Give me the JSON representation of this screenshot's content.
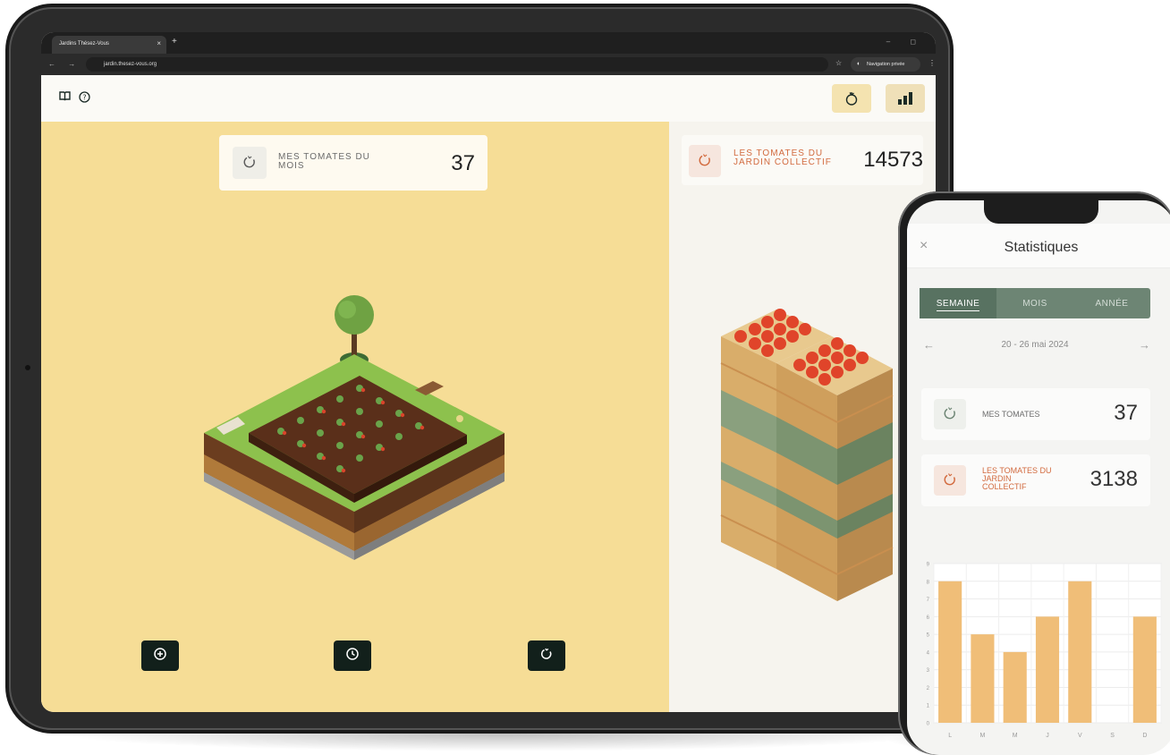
{
  "browser": {
    "tab_title": "Jardins Thésez-Vous",
    "tab_close": "×",
    "new_tab": "+",
    "window_controls": "–  ◻",
    "nav_buttons": "← → C",
    "url": "jardin.thesez-vous.org",
    "bookmark_icon": "star-icon",
    "private_label": "Navigation privée",
    "menu": "⋮"
  },
  "app_header": {
    "left_icons": [
      "book-icon",
      "help-icon"
    ],
    "right_buttons": [
      "tomato-icon",
      "stats-bars-icon"
    ]
  },
  "garden": {
    "card_label": "MES TOMATES DU MOIS",
    "card_value": "37",
    "actions": [
      "add-icon",
      "clock-icon",
      "tomato-icon"
    ]
  },
  "basket": {
    "card_label": "LES TOMATES DU JARDIN COLLECTIF",
    "card_value": "14573"
  },
  "phone": {
    "title": "Statistiques",
    "close": "×",
    "tabs": [
      {
        "label": "SEMAINE",
        "active": true
      },
      {
        "label": "MOIS",
        "active": false
      },
      {
        "label": "ANNÉE",
        "active": false
      }
    ],
    "date_range": "20 - 26 mai 2024",
    "prev": "←",
    "next": "→",
    "cards": [
      {
        "label": "MES TOMATES",
        "value": "37",
        "accent": "#6d8574"
      },
      {
        "label": "LES TOMATES DU JARDIN COLLECTIF",
        "value": "3138",
        "accent": "#d26a3e"
      }
    ]
  },
  "colors": {
    "garden_bg": "#f6dd96",
    "basket_bg": "#f6f4ee",
    "dark_button": "#12201b",
    "segment_green": "#6d8574",
    "bar_orange": "#f0be78",
    "tomato_red": "#d26a3e"
  },
  "chart_data": {
    "type": "bar",
    "categories": [
      "L",
      "M",
      "M",
      "J",
      "V",
      "S",
      "D"
    ],
    "values": [
      8,
      5,
      4,
      6,
      8,
      0,
      6
    ],
    "ylim": [
      0,
      9
    ],
    "yticks": [
      0,
      1,
      2,
      3,
      4,
      5,
      6,
      7,
      8,
      9
    ],
    "grid": true,
    "title": "",
    "xlabel": "",
    "ylabel": ""
  }
}
